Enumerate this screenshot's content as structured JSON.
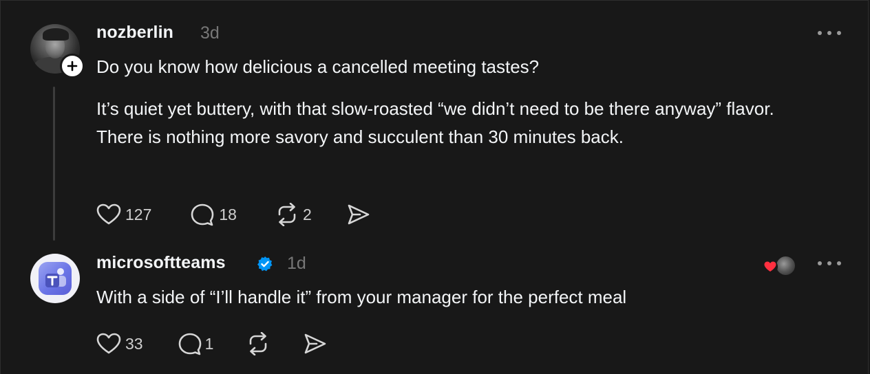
{
  "posts": [
    {
      "username": "nozberlin",
      "time": "3d",
      "headline": "Do you know how delicious a cancelled meeting tastes?",
      "body": "It’s quiet yet buttery, with that slow-roasted “we didn’t need to be there anyway” flavor. There is nothing more savory and succulent than 30 minutes back.",
      "likes": "127",
      "replies": "18",
      "reposts": "2",
      "avatar_icon": "user-photo-avatar",
      "follow_icon": "plus-icon"
    },
    {
      "username": "microsoftteams",
      "time": "1d",
      "verified": true,
      "body": "With a side of “I’ll handle it” from your manager for the perfect meal",
      "likes": "33",
      "replies": "1",
      "avatar_icon": "microsoft-teams-logo"
    }
  ],
  "colors": {
    "background": "#181818",
    "text": "#f3f5f7",
    "muted": "#777777",
    "verified": "#0095f6",
    "heart": "#ff3040"
  }
}
